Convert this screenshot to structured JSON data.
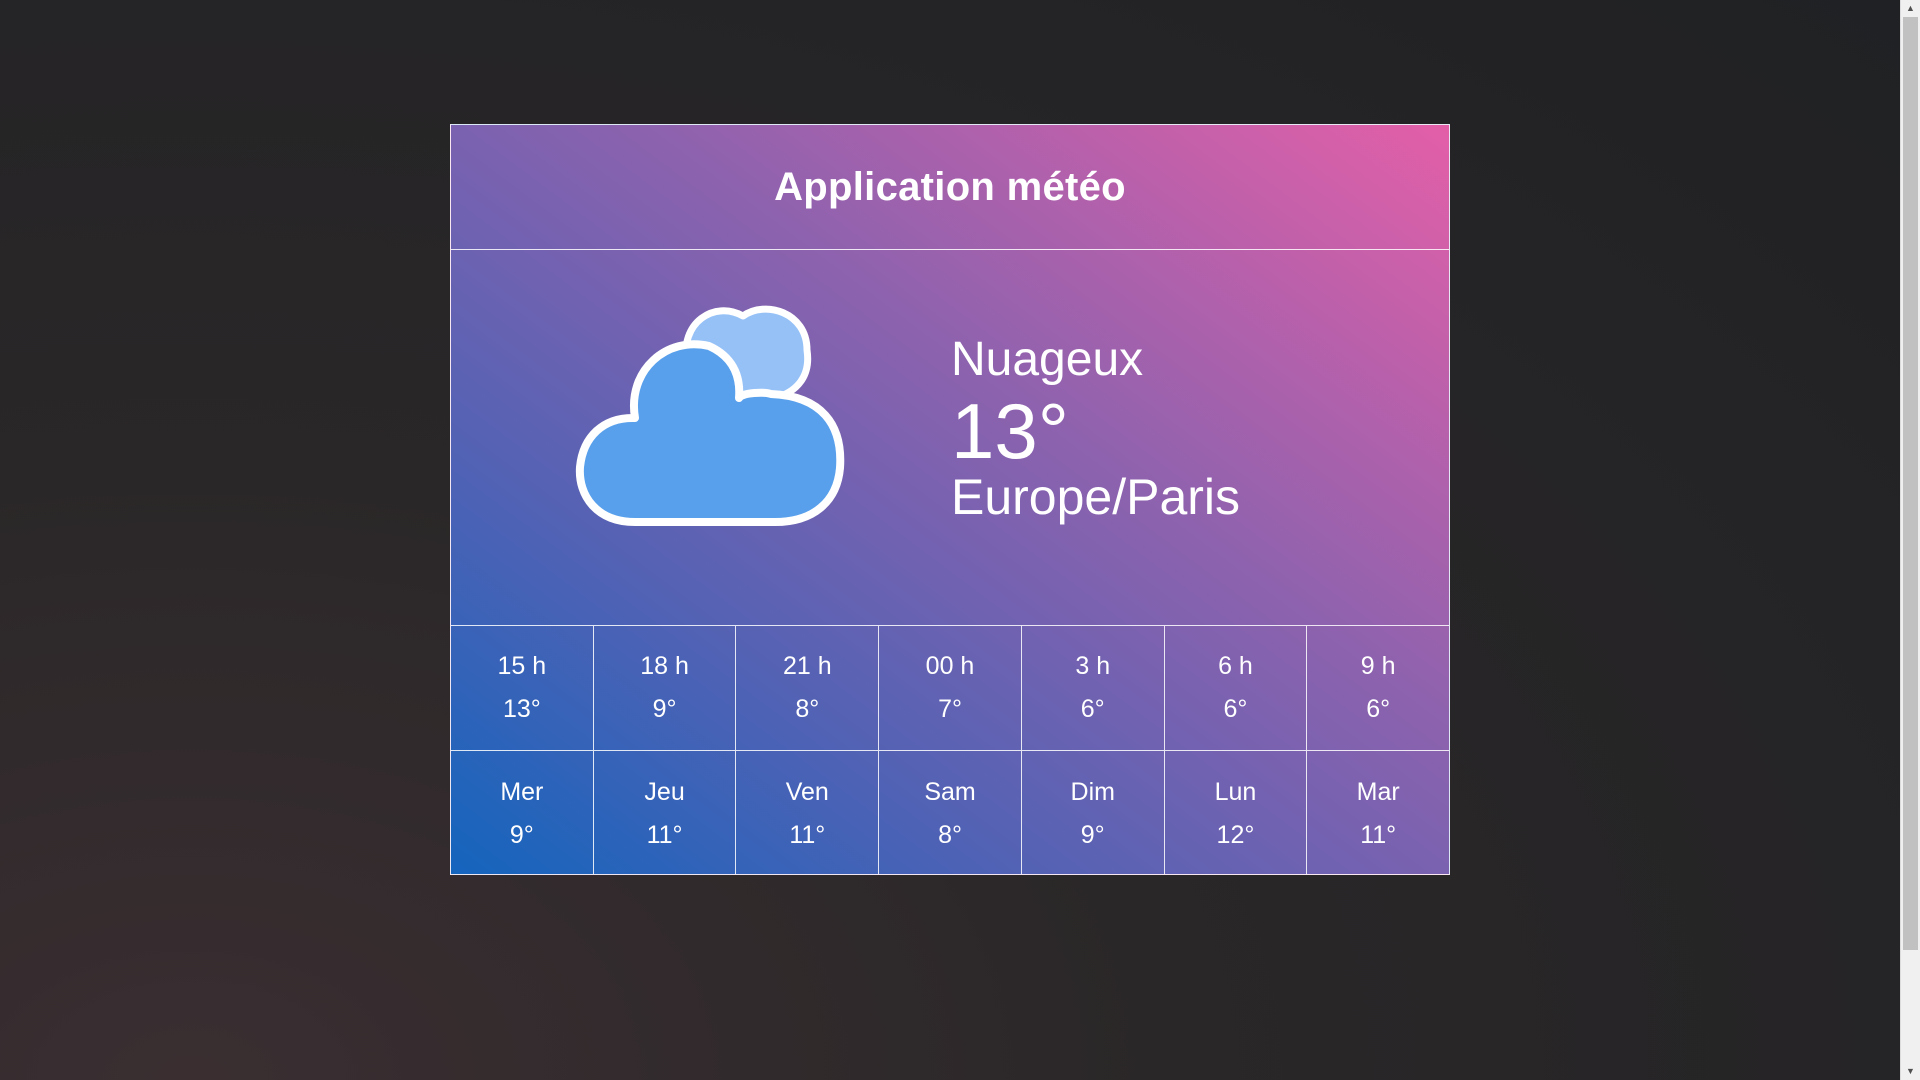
{
  "app": {
    "title": "Application météo"
  },
  "current": {
    "icon": "cloud-icon",
    "condition": "Nuageux",
    "temperature": "13°",
    "location": "Europe/Paris"
  },
  "hourly": [
    {
      "time": "15 h",
      "temp": "13°"
    },
    {
      "time": "18 h",
      "temp": "9°"
    },
    {
      "time": "21 h",
      "temp": "8°"
    },
    {
      "time": "00 h",
      "temp": "7°"
    },
    {
      "time": "3 h",
      "temp": "6°"
    },
    {
      "time": "6 h",
      "temp": "6°"
    },
    {
      "time": "9 h",
      "temp": "6°"
    }
  ],
  "daily": [
    {
      "day": "Mer",
      "temp": "9°"
    },
    {
      "day": "Jeu",
      "temp": "11°"
    },
    {
      "day": "Ven",
      "temp": "11°"
    },
    {
      "day": "Sam",
      "temp": "8°"
    },
    {
      "day": "Dim",
      "temp": "9°"
    },
    {
      "day": "Lun",
      "temp": "12°"
    },
    {
      "day": "Mar",
      "temp": "11°"
    }
  ],
  "colors": {
    "gradient_start": "#1464bd",
    "gradient_end": "#e35fa8",
    "cloud_front": "#58a0ec",
    "cloud_back": "#95c1f7"
  }
}
